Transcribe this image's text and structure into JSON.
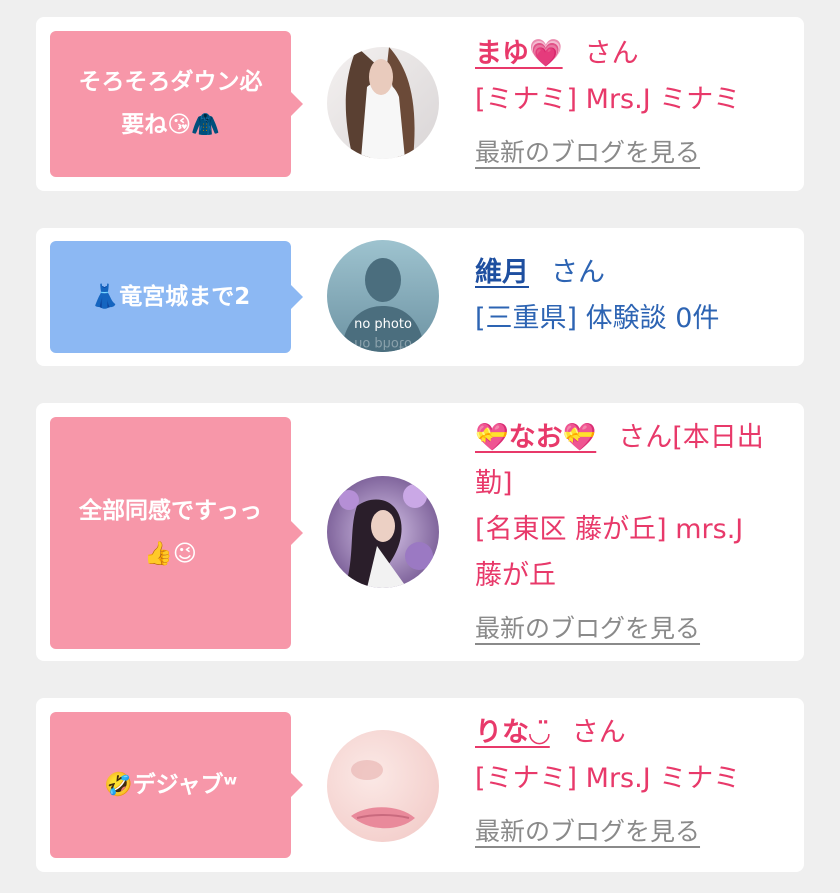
{
  "colors": {
    "pink_bubble": "#f797a9",
    "blue_bubble": "#8cb8f3",
    "pink_text": "#e8396a",
    "blue_text": "#2d64b3",
    "link_gray": "#8a8a8a"
  },
  "posts": [
    {
      "message_line1": "そろそろダウン必",
      "message_line2": "要ね😘🧥",
      "name": "まゆ💗",
      "honorific": "さん",
      "detail": "[ミナミ] Mrs.J ミナミ",
      "blog_link": "最新のブログを見る"
    },
    {
      "message_line1": "👗竜宮城まで2",
      "name": "維月",
      "honorific": "さん",
      "detail": "[三重県] 体験談 0件",
      "avatar_text": "no photo"
    },
    {
      "message_line1": "全部同感ですっっ",
      "message_line2": "👍😉",
      "name": "💝なお💝",
      "honorific": "さん[本日出",
      "honorific_cont": "勤]",
      "detail_line1": "[名東区 藤が丘] mrs.J",
      "detail_line2": "藤が丘",
      "blog_link": "最新のブログを見る"
    },
    {
      "message_line1": "🤣デジャブʷ",
      "name": "りな◡̈",
      "honorific": "さん",
      "detail": "[ミナミ] Mrs.J ミナミ",
      "blog_link": "最新のブログを見る"
    }
  ]
}
